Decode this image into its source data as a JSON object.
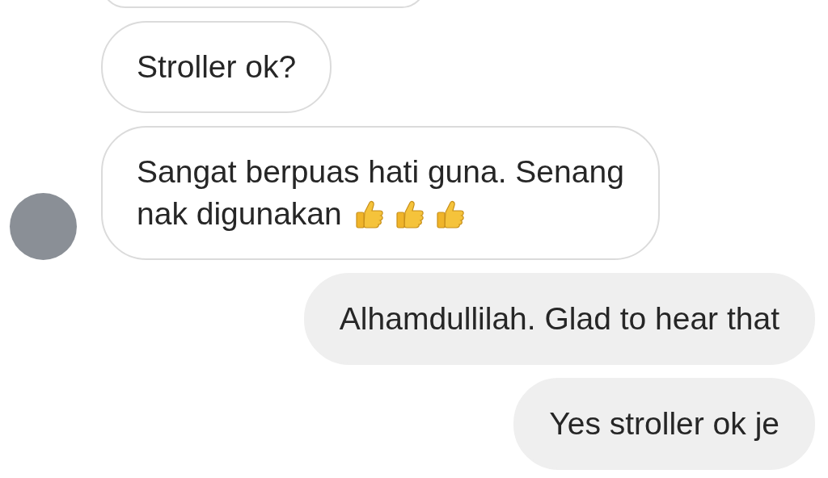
{
  "messages": [
    {
      "kind": "received",
      "lines": [
        "Stroller ok?"
      ]
    },
    {
      "kind": "received",
      "lines": [
        "Sangat berpuas hati guna. Senang",
        "nak digunakan"
      ],
      "avatar": true,
      "emoji": [
        {
          "kind": "thumbs_up"
        },
        {
          "kind": "thumbs_up"
        },
        {
          "kind": "thumbs_up"
        }
      ]
    },
    {
      "kind": "sent",
      "lines": [
        "Alhamdullilah. Glad to hear that"
      ]
    },
    {
      "kind": "sent",
      "lines": [
        "Yes stroller ok je"
      ]
    }
  ]
}
